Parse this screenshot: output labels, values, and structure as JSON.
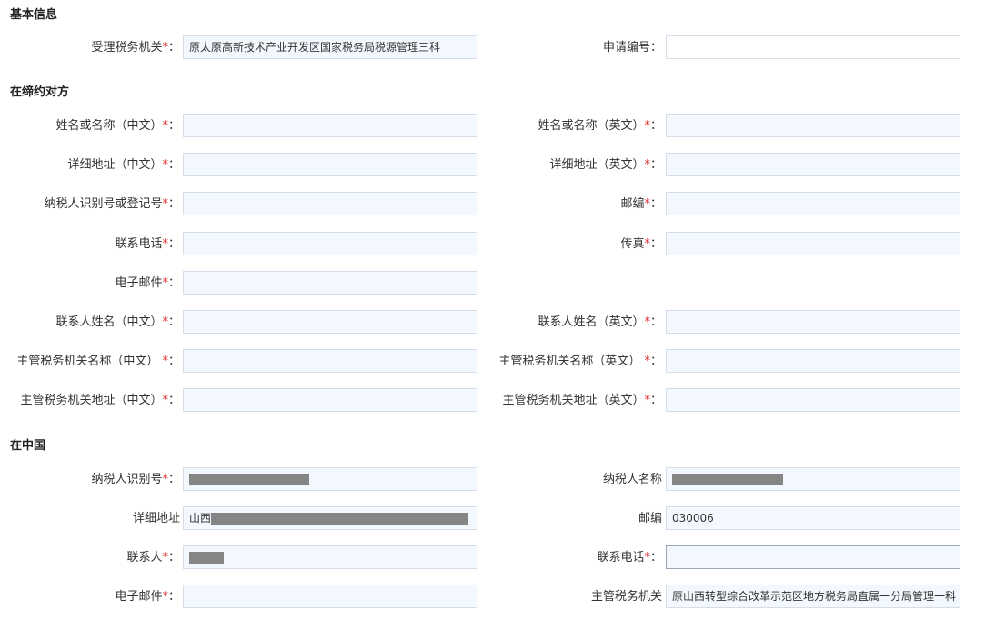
{
  "sections": {
    "basic": "基本信息",
    "counterparty": "在缔约对方",
    "china": "在中国"
  },
  "required_mark": "*",
  "basic": {
    "tax_office_label": "受理税务机关",
    "tax_office_value": "原太原高新技术产业开发区国家税务局税源管理三科",
    "app_no_label": "申请编号："
  },
  "counterparty": {
    "name_cn_label": "姓名或名称（中文）",
    "name_en_label": "姓名或名称（英文）",
    "addr_cn_label": "详细地址（中文）",
    "addr_en_label": "详细地址（英文）",
    "taxid_label": "纳税人识别号或登记号",
    "zip_label": "邮编",
    "phone_label": "联系电话",
    "fax_label": "传真",
    "email_label": "电子邮件",
    "contact_cn_label": "联系人姓名（中文）",
    "contact_en_label": "联系人姓名（英文）",
    "office_name_cn_label": "主管税务机关名称（中文）",
    "office_name_en_label": "主管税务机关名称（英文）",
    "office_addr_cn_label": "主管税务机关地址（中文）",
    "office_addr_en_label": "主管税务机关地址（英文）"
  },
  "china": {
    "taxid_label": "纳税人识别号",
    "name_label": "纳税人名称",
    "addr_label": "详细地址",
    "addr_prefix": "山西",
    "zip_label": "邮编",
    "zip_value": "030006",
    "contact_label": "联系人",
    "phone_label": "联系电话",
    "email_label": "电子邮件",
    "office_label": "主管税务机关",
    "office_value": "原山西转型综合改革示范区地方税务局直属一分局管理一科"
  },
  "colon": "："
}
